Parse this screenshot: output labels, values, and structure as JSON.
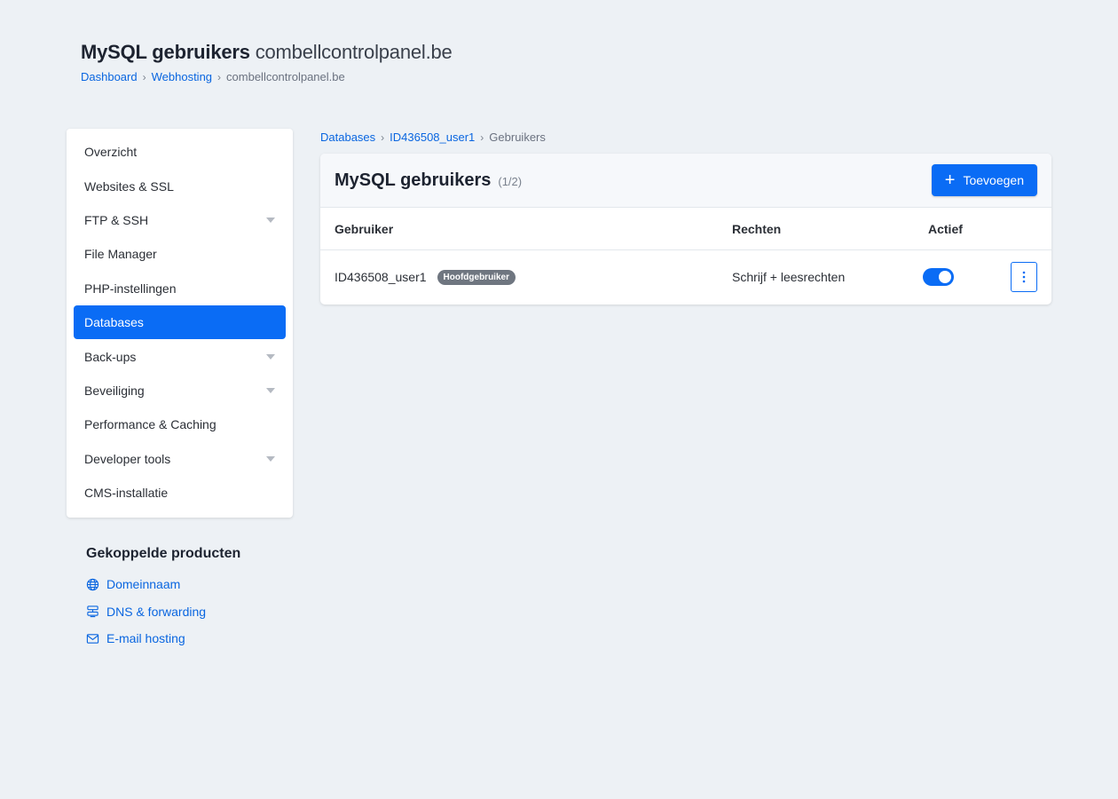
{
  "header": {
    "title": "MySQL gebruikers",
    "domain": "combellcontrolpanel.be",
    "breadcrumb": [
      "Dashboard",
      "Webhosting",
      "combellcontrolpanel.be"
    ]
  },
  "sidebar": {
    "items": [
      {
        "label": "Overzicht",
        "expandable": false,
        "active": false
      },
      {
        "label": "Websites & SSL",
        "expandable": false,
        "active": false
      },
      {
        "label": "FTP & SSH",
        "expandable": true,
        "active": false
      },
      {
        "label": "File Manager",
        "expandable": false,
        "active": false
      },
      {
        "label": "PHP-instellingen",
        "expandable": false,
        "active": false
      },
      {
        "label": "Databases",
        "expandable": false,
        "active": true
      },
      {
        "label": "Back-ups",
        "expandable": true,
        "active": false
      },
      {
        "label": "Beveiliging",
        "expandable": true,
        "active": false
      },
      {
        "label": "Performance & Caching",
        "expandable": false,
        "active": false
      },
      {
        "label": "Developer tools",
        "expandable": true,
        "active": false
      },
      {
        "label": "CMS-installatie",
        "expandable": false,
        "active": false
      }
    ]
  },
  "linked_products": {
    "title": "Gekoppelde producten",
    "items": [
      {
        "label": "Domeinnaam",
        "icon": "globe-icon"
      },
      {
        "label": "DNS & forwarding",
        "icon": "server-icon"
      },
      {
        "label": "E-mail hosting",
        "icon": "envelope-icon"
      }
    ]
  },
  "content": {
    "breadcrumb": [
      "Databases",
      "ID436508_user1",
      "Gebruikers"
    ],
    "card": {
      "title": "MySQL gebruikers",
      "count": "(1/2)",
      "add_label": "Toevoegen",
      "columns": {
        "user": "Gebruiker",
        "rights": "Rechten",
        "active": "Actief"
      },
      "rows": [
        {
          "user": "ID436508_user1",
          "badge": "Hoofdgebruiker",
          "rights": "Schrijf + leesrechten",
          "active": true
        }
      ]
    }
  },
  "colors": {
    "accent": "#0a6cf5",
    "link": "#0a66e0",
    "background": "#edf1f5",
    "badge": "#6f7680"
  }
}
